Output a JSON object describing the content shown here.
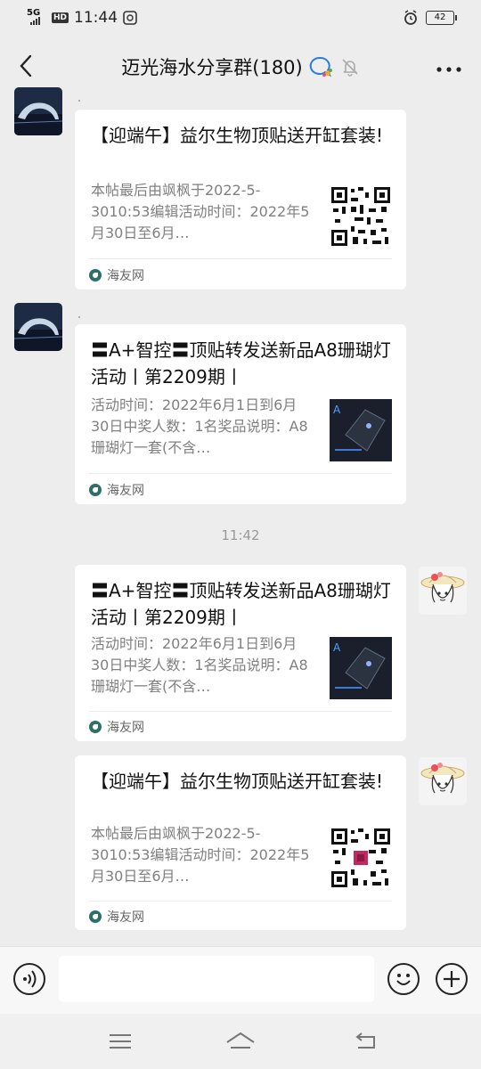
{
  "status_bar": {
    "network": "5G",
    "hd_badge": "HD",
    "time": "11:44",
    "battery": "42"
  },
  "header": {
    "back_icon": "chevron-left-icon",
    "title": "迈光海水分享群(180)",
    "more_icon": "more-dots-icon"
  },
  "messages": [
    {
      "sender_dot": ".",
      "title": "【迎端午】益尔生物顶贴送开缸套装!",
      "desc": "本帖最后由飒枫于2022-5-3010:53编辑活动时间：2022年5月30日至6月…",
      "source": "海友网",
      "thumb": "qr-code"
    },
    {
      "sender_dot": ".",
      "title": "〓A+智控〓顶贴转发送新品A8珊瑚灯活动丨第2209期丨",
      "desc": "活动时间：2022年6月1日到6月30日中奖人数：1名奖品说明：A8珊瑚灯一套(不含…",
      "source": "海友网",
      "thumb": "product-image"
    },
    {
      "title": "〓A+智控〓顶贴转发送新品A8珊瑚灯活动丨第2209期丨",
      "desc": "活动时间：2022年6月1日到6月30日中奖人数：1名奖品说明：A8珊瑚灯一套(不含…",
      "source": "海友网",
      "thumb": "product-image"
    },
    {
      "title": "【迎端午】益尔生物顶贴送开缸套装!",
      "desc": "本帖最后由飒枫于2022-5-3010:53编辑活动时间：2022年5月30日至6月…",
      "source": "海友网",
      "thumb": "qr-code"
    }
  ],
  "timestamp": "11:42",
  "colors": {
    "background": "#ededed",
    "card": "#ffffff",
    "desc_text": "#808080"
  }
}
